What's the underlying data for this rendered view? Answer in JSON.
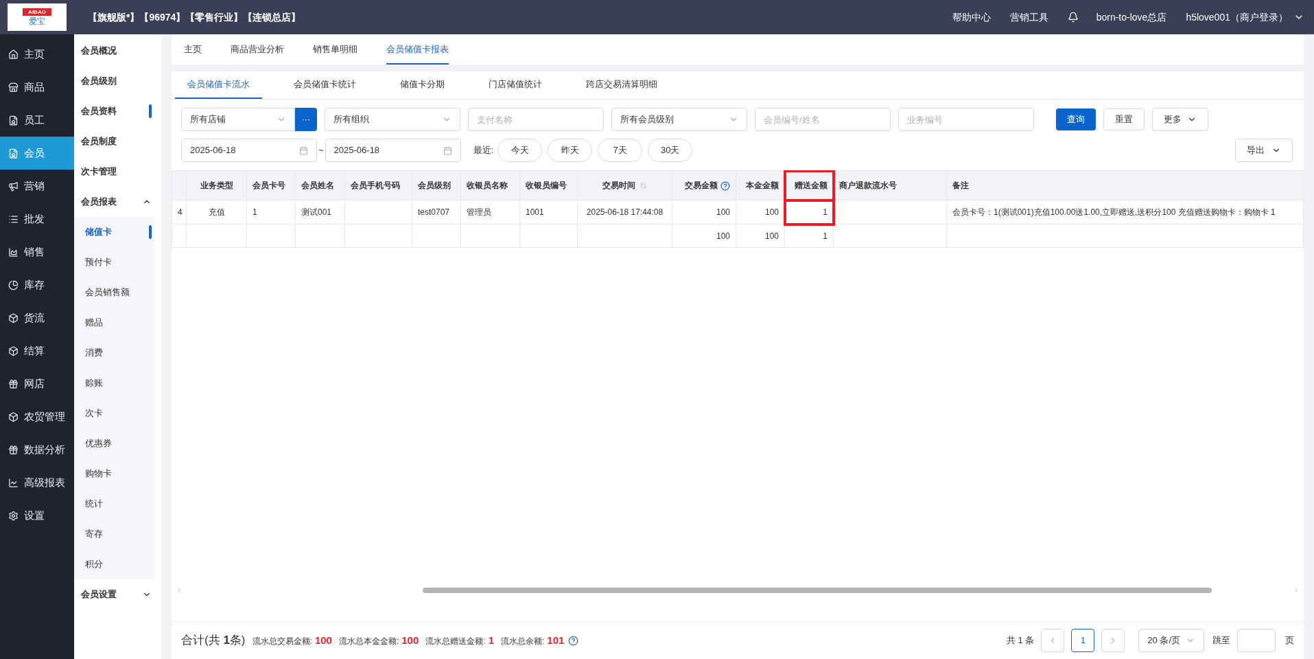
{
  "header": {
    "logo": {
      "top": "AIBAO",
      "bottom": "爱宝"
    },
    "tags": [
      "【旗舰版*】",
      "【96974】",
      "【零售行业】",
      "【连锁总店】"
    ],
    "links": [
      "帮助中心",
      "营销工具"
    ],
    "store": "born-to-love总店",
    "user": "h5love001（商户登录）"
  },
  "nav": [
    {
      "label": "主页",
      "selected": false
    },
    {
      "label": "商品",
      "selected": false
    },
    {
      "label": "员工",
      "selected": false
    },
    {
      "label": "会员",
      "selected": true
    },
    {
      "label": "营销",
      "selected": false
    },
    {
      "label": "批发",
      "selected": false
    },
    {
      "label": "销售",
      "selected": false
    },
    {
      "label": "库存",
      "selected": false
    },
    {
      "label": "货流",
      "selected": false
    },
    {
      "label": "结算",
      "selected": false
    },
    {
      "label": "网店",
      "selected": false
    },
    {
      "label": "农贸管理",
      "selected": false
    },
    {
      "label": "数据分析",
      "selected": false
    },
    {
      "label": "高级报表",
      "selected": false
    },
    {
      "label": "设置",
      "selected": false
    }
  ],
  "submenu": [
    {
      "label": "会员概况",
      "marked": false
    },
    {
      "label": "会员级别",
      "marked": false
    },
    {
      "label": "会员资料",
      "marked": true
    },
    {
      "label": "会员制度",
      "marked": false
    },
    {
      "label": "次卡管理",
      "marked": false
    },
    {
      "label": "会员报表",
      "marked": false,
      "expanded": true,
      "children": [
        {
          "label": "储值卡",
          "selected": true
        },
        {
          "label": "预付卡",
          "selected": false
        },
        {
          "label": "会员销售额",
          "selected": false
        },
        {
          "label": "赠品",
          "selected": false
        },
        {
          "label": "消费",
          "selected": false
        },
        {
          "label": "赊账",
          "selected": false
        },
        {
          "label": "次卡",
          "selected": false
        },
        {
          "label": "优惠券",
          "selected": false
        },
        {
          "label": "购物卡",
          "selected": false
        },
        {
          "label": "统计",
          "selected": false
        },
        {
          "label": "寄存",
          "selected": false
        },
        {
          "label": "积分",
          "selected": false
        }
      ]
    },
    {
      "label": "会员设置",
      "marked": false,
      "expanded": false
    }
  ],
  "tabs": [
    {
      "label": "主页",
      "selected": false
    },
    {
      "label": "商品营业分析",
      "selected": false
    },
    {
      "label": "销售单明细",
      "selected": false
    },
    {
      "label": "会员储值卡报表",
      "selected": true
    }
  ],
  "sub_tabs": [
    {
      "label": "会员储值卡流水",
      "selected": true
    },
    {
      "label": "会员储值卡统计",
      "selected": false
    },
    {
      "label": "储值卡分期",
      "selected": false
    },
    {
      "label": "门店储值统计",
      "selected": false
    },
    {
      "label": "跨店交易清算明细",
      "selected": false
    }
  ],
  "filters": [
    {
      "kind": "select",
      "value": "所有店铺",
      "more": "···"
    },
    {
      "kind": "select",
      "value": "所有组织"
    },
    {
      "kind": "input",
      "placeholder": "支付名称"
    },
    {
      "kind": "select",
      "value": "所有会员级别"
    },
    {
      "kind": "input",
      "placeholder": "会员编号/姓名"
    },
    {
      "kind": "input",
      "placeholder": "业务编号"
    }
  ],
  "buttons": [
    {
      "label": "查询",
      "kind": "primary"
    },
    {
      "label": "重置",
      "kind": "plain"
    },
    {
      "label": "更多",
      "kind": "dropdown"
    }
  ],
  "date_from": "2025-06-18",
  "date_sep": "~",
  "date_to": "2025-06-18",
  "recent_label": "最近:",
  "recent": [
    "今天",
    "昨天",
    "7天",
    "30天"
  ],
  "export": "导出",
  "table": {
    "columns": [
      {},
      {
        "label": "业务类型"
      },
      {
        "label": "会员卡号"
      },
      {
        "label": "会员姓名"
      },
      {
        "label": "会员手机号码"
      },
      {
        "label": "会员级别"
      },
      {
        "label": "收银员名称"
      },
      {
        "label": "收银员编号"
      },
      {
        "label": "交易时间",
        "sort": true
      },
      {
        "label": "交易金额",
        "help": true
      },
      {
        "label": "本金金额"
      },
      {
        "label": "赠送金额",
        "highlighted": true
      },
      {
        "label": "商户退款流水号"
      },
      {
        "label": "备注"
      }
    ],
    "rows": [
      {
        "column_1": "4",
        "business_type": "充值",
        "card_no": "1",
        "member_name": "测试001",
        "member_level": "test0707",
        "cashier_name": "管理员",
        "cashier_no": "1001",
        "time": "2025-06-18 17:44:08",
        "trade_amount": "100",
        "principal_amount": "100",
        "bonus_amount": "1",
        "remark": "会员卡号：1(测试001)充值100.00送1.00,立即赠送,送积分100 充值赠送购物卡：购物卡 1"
      }
    ],
    "totals": {
      "trade_amount": "100",
      "principal_amount": "100",
      "bonus_amount": "1"
    }
  },
  "footer": {
    "title": "合计(共 ",
    "count": "1",
    "title_end": "条)",
    "stats": [
      {
        "label": "流水总交易金额:",
        "value": "100"
      },
      {
        "label": "流水总本金金额:",
        "value": "100"
      },
      {
        "label": "流水总赠送金额:",
        "value": "1"
      },
      {
        "label": "流水总余额:",
        "value": "101"
      }
    ],
    "total": "共 1 条",
    "pages": [
      {
        "label": "1",
        "selected": true
      }
    ],
    "page_size": "20 条/页",
    "jump": "跳至",
    "page_unit": "页"
  }
}
